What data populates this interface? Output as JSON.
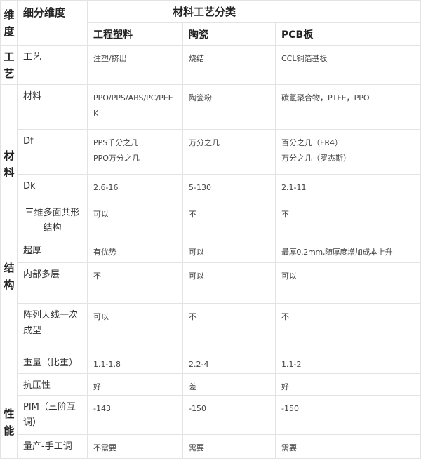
{
  "header": {
    "dimension": "维度",
    "sub_dimension": "细分维度",
    "group": "材料工艺分类",
    "col_a": "工程塑料",
    "col_b": "陶瓷",
    "col_c": "PCB板"
  },
  "sections": {
    "process": {
      "label": "工艺",
      "rows": [
        {
          "name": "工艺",
          "a": "注塑/挤出",
          "b": "烧结",
          "c": "CCL铜箔基板"
        }
      ]
    },
    "material": {
      "label": "材料",
      "rows": [
        {
          "name": "材料",
          "a": "PPO/PPS/ABS/PC/PEEK",
          "b": "陶瓷粉",
          "c": "碳氢聚合物，PTFE，PPO"
        },
        {
          "name": "Df",
          "a": "PPS千分之几\nPPO万分之几",
          "b": "万分之几",
          "c": "百分之几（FR4）\n万分之几（罗杰斯）"
        },
        {
          "name": "Dk",
          "a": "2.6-16",
          "b": "5-130",
          "c": "2.1-11"
        }
      ]
    },
    "structure": {
      "label": "结构",
      "rows": [
        {
          "name": "三维多面共形结构",
          "a": "可以",
          "b": "不",
          "c": "不"
        },
        {
          "name": "超厚",
          "a": "有优势",
          "b": "可以",
          "c": "最厚0.2mm,随厚度增加成本上升"
        },
        {
          "name": "内部多层",
          "a": "不",
          "b": "可以",
          "c": "可以"
        },
        {
          "name": "阵列天线一次成型",
          "a": "可以",
          "b": "不",
          "c": "不"
        }
      ]
    },
    "performance": {
      "label": "性能",
      "rows": [
        {
          "name": "重量（比重）",
          "a": "1.1-1.8",
          "b": "2.2-4",
          "c": "1.1-2"
        },
        {
          "name": "抗压性",
          "a": "好",
          "b": "差",
          "c": "好"
        },
        {
          "name": "PIM（三阶互调）",
          "a": "-143",
          "b": "-150",
          "c": "-150"
        },
        {
          "name": "量产-手工调",
          "a": "不需要",
          "b": "需要",
          "c": "需要"
        }
      ]
    }
  }
}
